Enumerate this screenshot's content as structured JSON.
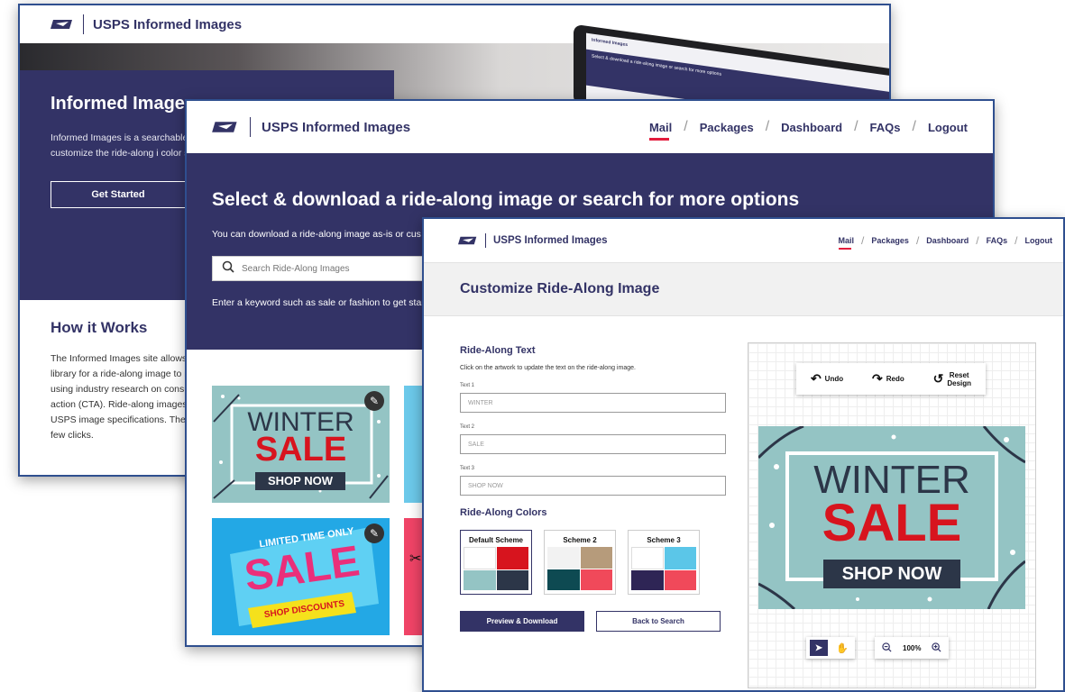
{
  "colors": {
    "navy": "#333366",
    "red": "#e31c3d",
    "teal": "#94c4c4"
  },
  "window1": {
    "brand": "USPS Informed Images",
    "hero_title": "Informed Images",
    "hero_text": "Informed Images is a searchable ir designed ride-along images for us You can customize the ride-along i color scheme to better match your",
    "get_started": "Get Started",
    "how_title": "How it Works",
    "how_text": "The Informed Images site allows b library for a ride-along image to me using industry research on consum action (CTA). Ride-along images ar USPS image specifications. The im few clicks.",
    "device_title": "Informed Images",
    "device_heading": "Select & download a ride-along image or search for more options"
  },
  "window2": {
    "brand": "USPS Informed Images",
    "nav": [
      "Mail",
      "Packages",
      "Dashboard",
      "FAQs",
      "Logout"
    ],
    "heading": "Select & download a ride-along image or search for more options",
    "sub": "You can download a ride-along image as-is or cus",
    "search_placeholder": "Search Ride-Along Images",
    "hint": "Enter a keyword such as sale or fashion to get star",
    "tiles": {
      "winter": {
        "line1": "WINTER",
        "line2": "SALE",
        "line3": "SHOP NOW"
      },
      "limited": {
        "line1": "LIMITED TIME ONLY",
        "line2": "SALE",
        "line3": "SHOP DISCOUNTS"
      }
    }
  },
  "window3": {
    "brand": "USPS Informed Images",
    "nav": [
      "Mail",
      "Packages",
      "Dashboard",
      "FAQs",
      "Logout"
    ],
    "title": "Customize Ride-Along Image",
    "text_section": "Ride-Along Text",
    "text_desc": "Click on the artwork to update the text on the ride-along image.",
    "fields": [
      {
        "label": "Text 1",
        "value": "WINTER"
      },
      {
        "label": "Text 2",
        "value": "SALE"
      },
      {
        "label": "Text 3",
        "value": "SHOP NOW"
      }
    ],
    "colors_section": "Ride-Along Colors",
    "schemes": [
      {
        "name": "Default Scheme",
        "swatches": [
          "#ffffff",
          "#d7141e",
          "#94c4c4",
          "#2c3648"
        ]
      },
      {
        "name": "Scheme 2",
        "swatches": [
          "#f2f2f2",
          "#b69b7b",
          "#0e4a52",
          "#f0495a"
        ]
      },
      {
        "name": "Scheme 3",
        "swatches": [
          "#ffffff",
          "#5bc6e8",
          "#2e2555",
          "#f0495a"
        ]
      }
    ],
    "preview_button": "Preview & Download",
    "back_button": "Back to Search",
    "toolbar": {
      "undo": "Undo",
      "redo": "Redo",
      "reset1": "Reset",
      "reset2": "Design"
    },
    "zoom": "100%",
    "art": {
      "line1": "WINTER",
      "line2": "SALE",
      "line3": "SHOP NOW"
    }
  }
}
